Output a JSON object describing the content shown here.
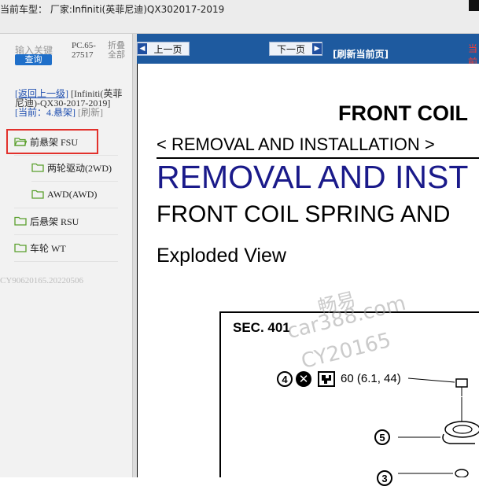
{
  "window": {
    "title": "当前车型： 厂家:Infiniti(英菲尼迪)QX302017-2019"
  },
  "sidebar": {
    "search_placeholder": "输入关键",
    "search_button": "查询",
    "pc_code": "PC.65-27517",
    "fold_all": "折叠全部",
    "back_link": "[返回上一级]",
    "model_text": "[Infiniti(英菲尼迪)-QX30-2017-2019]",
    "current_label": "[当前：4.悬架]",
    "refresh_link": "[刷新]",
    "items": [
      {
        "label": "前悬架 FSU"
      },
      {
        "label": "两轮驱动(2WD)"
      },
      {
        "label": "AWD(AWD)"
      },
      {
        "label": "后悬架 RSU"
      },
      {
        "label": "车轮 WT"
      }
    ],
    "watermark": "CY90620165.20220506"
  },
  "toolbar": {
    "prev_label": "上一页",
    "next_label": "下一页",
    "refresh_label": "[刷新当前页]",
    "cut_text": "当前"
  },
  "document": {
    "heading1": "FRONT COIL",
    "heading2": "< REMOVAL AND INSTALLATION >",
    "heading3": "REMOVAL AND INST",
    "heading4": "FRONT COIL SPRING AND",
    "heading5": "Exploded View",
    "figure": {
      "section": "SEC. 401",
      "callout_4": "4",
      "callout_5": "5",
      "callout_3": "3",
      "torque": "60 (6.1, 44)"
    },
    "watermark": {
      "line1": "畅易",
      "line2": "car388.com",
      "line3": "CY20165"
    }
  },
  "colors": {
    "toolbar_bg": "#1e5a9f",
    "highlight_border": "#e2312c",
    "heading_blue": "#1a1a8a",
    "search_button": "#1f6fc9"
  }
}
